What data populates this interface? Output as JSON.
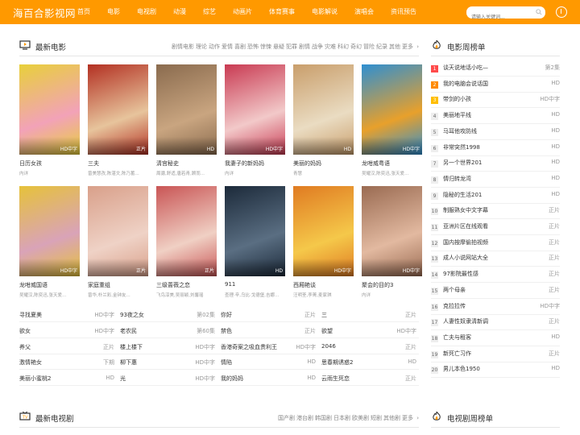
{
  "site": {
    "logo": "海百合影视网",
    "nav": [
      "首页",
      "电影",
      "电视剧",
      "动漫",
      "综艺",
      "动画片",
      "体育赛事",
      "电影解说",
      "演唱会",
      "资讯预告"
    ],
    "search_placeholder": "请输入关键词..."
  },
  "movies_section": {
    "title": "最新电影",
    "genres": [
      "剧情电影",
      "理论",
      "动作",
      "爱情",
      "喜剧",
      "恐怖",
      "惊悚",
      "悬疑",
      "犯罪",
      "剧情",
      "战争",
      "灾难",
      "科幻",
      "奇幻",
      "冒险",
      "纪录",
      "其他",
      "更多"
    ]
  },
  "posters": [
    {
      "title": "日历女孩",
      "cast": "内详",
      "badge": "HD中字",
      "c1": "#e8d03a",
      "c2": "#f2a2b8"
    },
    {
      "title": "三夫",
      "cast": "曾美慧孜,陈湛文,陈乃蓄...",
      "badge": "正片",
      "c1": "#b33022",
      "c2": "#e7c49c"
    },
    {
      "title": "清宫秘史",
      "cast": "周骢,舒适,唐若青,顾而...",
      "badge": "HD",
      "c1": "#8a6b4e",
      "c2": "#c9a580"
    },
    {
      "title": "我妻子的新妈妈",
      "cast": "内详",
      "badge": "HD中字",
      "c1": "#c93a52",
      "c2": "#f2c9c9"
    },
    {
      "title": "美丽的妈妈",
      "cast": "青慧",
      "badge": "HD",
      "c1": "#c99e6b",
      "c2": "#eadcc2"
    },
    {
      "title": "龙咁威粤语",
      "cast": "吴耀汉,陈奕迅,张天爱...",
      "badge": "HD中字",
      "c1": "#2e8fd2",
      "c2": "#e8a02b"
    },
    {
      "title": "龙咁威国语",
      "cast": "吴耀汉,陈奕迅,张天爱...",
      "badge": "HD中字",
      "c1": "#e6c23a",
      "c2": "#d9a3b8"
    },
    {
      "title": "家庭重组",
      "cast": "曾华,朴兰彩,金钟友...",
      "badge": "正片",
      "c1": "#d9a08a",
      "c2": "#efd2c6"
    },
    {
      "title": "三级蔷薇之恋",
      "cast": "飞鸟淳美,吴丽颖,刘馨瑶",
      "badge": "正片",
      "c1": "#c95555",
      "c2": "#f0d0c4"
    },
    {
      "title": "911",
      "cast": "查理·辛,乌比·戈德堡,吉娜...",
      "badge": "HD",
      "c1": "#1c2a3a",
      "c2": "#5a6e82"
    },
    {
      "title": "西厢艳谈",
      "cast": "汪明荃,李菁,麦家琪",
      "badge": "HD中字",
      "c1": "#e07b22",
      "c2": "#f5c84a"
    },
    {
      "title": "聚会的目的3",
      "cast": "内详",
      "badge": "HD中字",
      "c1": "#9a6b52",
      "c2": "#e2b9a0"
    }
  ],
  "text_list": [
    [
      {
        "name": "寻找夏美",
        "badge": "HD中字"
      },
      {
        "name": "93夜之女",
        "badge": "第02集"
      },
      {
        "name": "你好",
        "badge": "正片"
      },
      {
        "name": "三",
        "badge": "正片"
      }
    ],
    [
      {
        "name": "欲女",
        "badge": "HD中字"
      },
      {
        "name": "老农民",
        "badge": "第60集"
      },
      {
        "name": "禁色",
        "badge": "正片"
      },
      {
        "name": "欲望",
        "badge": "HD中字"
      }
    ],
    [
      {
        "name": "养父",
        "badge": "正片"
      },
      {
        "name": "楼上楼下",
        "badge": "HD中字"
      },
      {
        "name": "香港奇案之吸血贵利王",
        "badge": "HD中字"
      },
      {
        "name": "2046",
        "badge": "正片"
      }
    ],
    [
      {
        "name": "激情艳女",
        "badge": "下期"
      },
      {
        "name": "柳下惠",
        "badge": "HD中字"
      },
      {
        "name": "情陷",
        "badge": "HD"
      },
      {
        "name": "思春期诱惑2",
        "badge": "HD"
      }
    ],
    [
      {
        "name": "美丽小蜜桃2",
        "badge": "HD"
      },
      {
        "name": "光",
        "badge": "HD中字"
      },
      {
        "name": "我的妈妈",
        "badge": "HD"
      },
      {
        "name": "云雨生死恋",
        "badge": "正片"
      }
    ]
  ],
  "movie_rank": {
    "title": "电影周榜单",
    "items": [
      {
        "n": "1",
        "name": "谈天说地话小吃—",
        "status": "第2集"
      },
      {
        "n": "2",
        "name": "我的电脑会说话国",
        "status": "HD"
      },
      {
        "n": "3",
        "name": "带剑的小孩",
        "status": "HD中字"
      },
      {
        "n": "4",
        "name": "美丽地平线",
        "status": "HD"
      },
      {
        "n": "5",
        "name": "马耳他攻防线",
        "status": "HD"
      },
      {
        "n": "6",
        "name": "非常突然1998",
        "status": "HD"
      },
      {
        "n": "7",
        "name": "另一个世界201",
        "status": "HD"
      },
      {
        "n": "8",
        "name": "情归转龙湾",
        "status": "HD"
      },
      {
        "n": "9",
        "name": "隐秘的生活201",
        "status": "HD"
      },
      {
        "n": "10",
        "name": "制服熟女中文字幕",
        "status": "正片"
      },
      {
        "n": "11",
        "name": "亚洲片区在线观看",
        "status": "正片"
      },
      {
        "n": "12",
        "name": "国内按摩偷拍视频",
        "status": "正片"
      },
      {
        "n": "13",
        "name": "成人小说网站大全",
        "status": "正片"
      },
      {
        "n": "14",
        "name": "97影院最性感",
        "status": "正片"
      },
      {
        "n": "15",
        "name": "两个母亲",
        "status": "正片"
      },
      {
        "n": "16",
        "name": "克拉拉传",
        "status": "HD中字"
      },
      {
        "n": "17",
        "name": "人妻性奴隶清新调",
        "status": "正片"
      },
      {
        "n": "18",
        "name": "亡夫与租客",
        "status": "HD"
      },
      {
        "n": "19",
        "name": "新死亡习作",
        "status": "正片"
      },
      {
        "n": "20",
        "name": "男儿本色1950",
        "status": "HD"
      }
    ]
  },
  "tv_section": {
    "title": "最新电视剧",
    "genres": [
      "国产剧",
      "港台剧",
      "韩国剧",
      "日本剧",
      "欧美剧",
      "短剧",
      "其他剧",
      "更多"
    ]
  },
  "tv_rank": {
    "title": "电视剧周榜单"
  }
}
